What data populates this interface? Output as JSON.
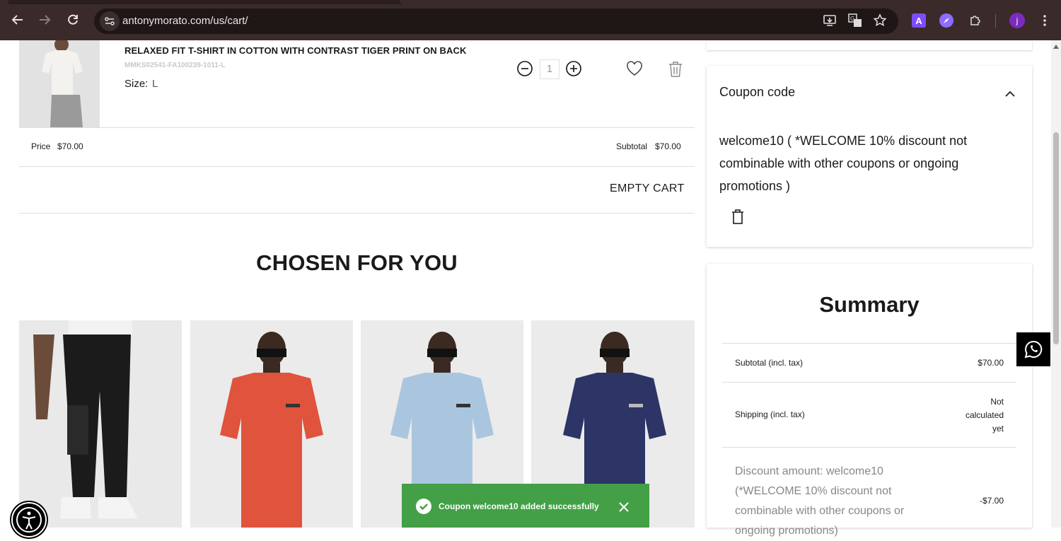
{
  "browser": {
    "url": "antonymorato.com/us/cart/",
    "profile_initial": "j",
    "extension_a_label": "A"
  },
  "cart_item": {
    "name": "RELAXED FIT T-SHIRT IN COTTON WITH CONTRAST TIGER PRINT ON BACK",
    "sku": "MMKS02541-FA100239-1011-L",
    "size_label": "Size:",
    "size_value": "L",
    "quantity": "1",
    "price_label": "Price",
    "price_value": "$70.00",
    "subtotal_label": "Subtotal",
    "subtotal_value": "$70.00"
  },
  "empty_cart_label": "EMPTY CART",
  "recommendations": {
    "title": "CHOSEN FOR YOU",
    "products": [
      {
        "color": "#1b1b1b",
        "kind": "pants"
      },
      {
        "color": "#e0533d",
        "kind": "tshirt"
      },
      {
        "color": "#a9c6de",
        "kind": "tshirt"
      },
      {
        "color": "#2c3566",
        "kind": "tshirt"
      }
    ]
  },
  "coupon": {
    "title": "Coupon code",
    "applied_text": "welcome10 ( *WELCOME 10% discount not combinable with other coupons or ongoing promotions )"
  },
  "summary": {
    "title": "Summary",
    "subtotal_label": "Subtotal (incl. tax)",
    "subtotal_value": "$70.00",
    "shipping_label": "Shipping (incl. tax)",
    "shipping_value": "Not calculated yet",
    "discount_label": "Discount amount: welcome10 (*WELCOME 10% discount not combinable with other coupons or ongoing promotions)",
    "discount_value": "-$7.00"
  },
  "toast": {
    "message": "Coupon welcome10 added successfully",
    "color": "#43a047"
  }
}
